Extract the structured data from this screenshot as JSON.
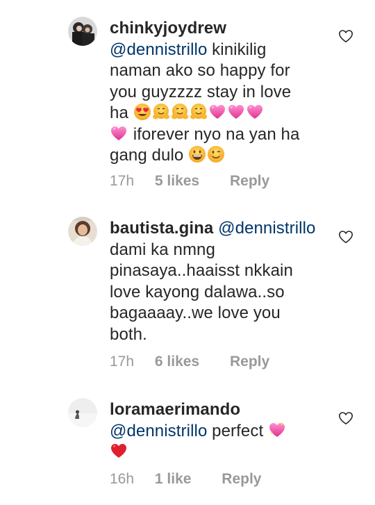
{
  "comments": [
    {
      "username": "chinkyjoydrew",
      "mention": "@dennistrillo",
      "text_lines": [
        " kinikilig",
        "naman ako so happy for",
        "you guyzzzz stay in love",
        "ha ",
        " iforever nyo na yan ha",
        "gang dulo "
      ],
      "emojis_line4": [
        "heart-eyes",
        "hugging",
        "hugging",
        "hugging",
        "pink-heart",
        "pink-heart",
        "pink-heart"
      ],
      "emojis_line5": [
        "pink-heart"
      ],
      "emojis_line6": [
        "grinning",
        "winking"
      ],
      "time": "17h",
      "likes": "5 likes",
      "reply": "Reply"
    },
    {
      "username": "bautista.gina",
      "mention": "@dennistrillo",
      "text_lines": [
        "dami ka nmng",
        "pinasaya..haaisst nkkain",
        "love kayong dalawa..so",
        "bagaaaay..we love you",
        "both."
      ],
      "time": "17h",
      "likes": "6 likes",
      "reply": "Reply"
    },
    {
      "username": "loramaerimando",
      "mention": "@dennistrillo",
      "text": " perfect ",
      "emojis_line1": [
        "sparkling-heart"
      ],
      "emojis_line2": [
        "red-heart"
      ],
      "time": "16h",
      "likes": "1 like",
      "reply": "Reply"
    }
  ],
  "colors": {
    "text": "#262626",
    "mention": "#003569",
    "meta": "#999999",
    "background": "#ffffff"
  }
}
